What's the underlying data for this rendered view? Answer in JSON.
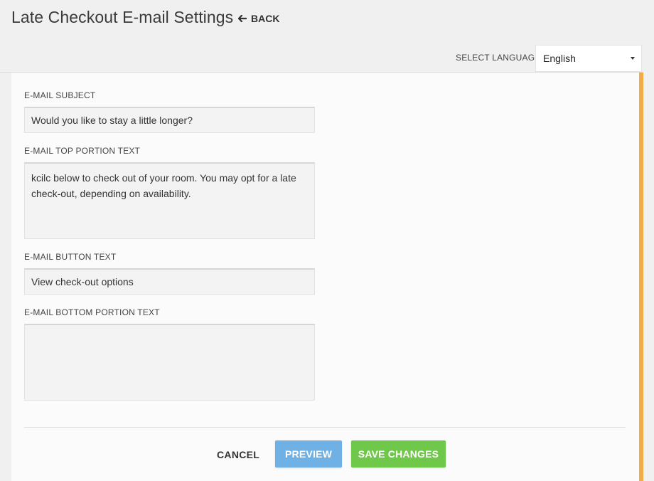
{
  "header": {
    "title": "Late Checkout E-mail Settings",
    "back_label": "BACK"
  },
  "language": {
    "label": "SELECT LANGUAGE",
    "selected": "English"
  },
  "form": {
    "subject": {
      "label": "E-MAIL SUBJECT",
      "value": "Would you like to stay a little longer?"
    },
    "top_text": {
      "label": "E-MAIL TOP PORTION TEXT",
      "value": "kcilc below to check out of your room. You may opt for a late check-out, depending on availability."
    },
    "button_text": {
      "label": "E-MAIL BUTTON TEXT",
      "value": "View check-out options"
    },
    "bottom_text": {
      "label": "E-MAIL BOTTOM PORTION TEXT",
      "value": ""
    }
  },
  "actions": {
    "cancel": "CANCEL",
    "preview": "PREVIEW",
    "save": "SAVE CHANGES"
  },
  "colors": {
    "accent": "#f0ad45",
    "preview_button": "#6fb1e4",
    "save_button": "#6fc84a"
  }
}
